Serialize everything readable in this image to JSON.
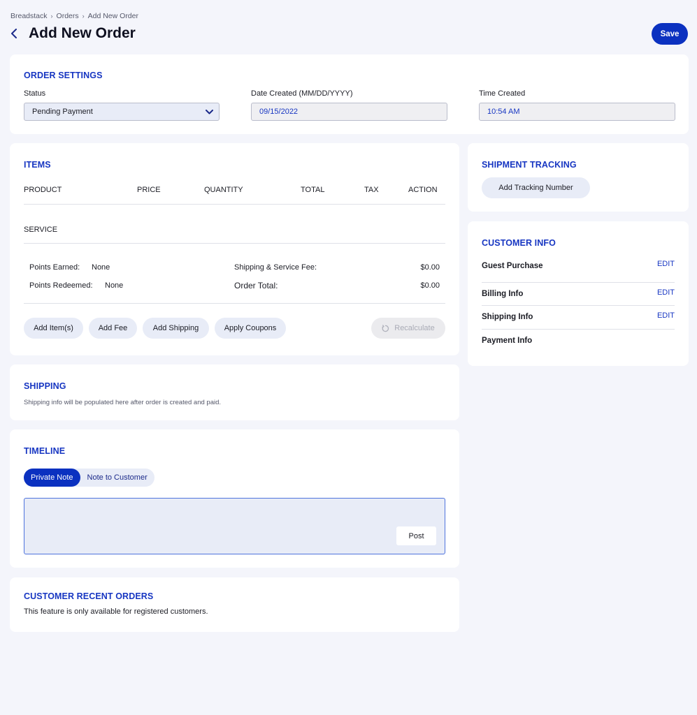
{
  "breadcrumb": [
    "Breadstack",
    "Orders",
    "Add New Order"
  ],
  "page_title": "Add New Order",
  "save_label": "Save",
  "order_settings": {
    "title": "ORDER SETTINGS",
    "status_label": "Status",
    "status_value": "Pending Payment",
    "date_label": "Date Created (MM/DD/YYYY)",
    "date_value": "09/15/2022",
    "time_label": "Time Created",
    "time_value": "10:54 AM"
  },
  "items": {
    "title": "ITEMS",
    "columns": [
      "PRODUCT",
      "PRICE",
      "QUANTITY",
      "TOTAL",
      "TAX",
      "ACTION"
    ],
    "service_label": "SERVICE",
    "points_earned_label": "Points Earned:",
    "points_earned_value": "None",
    "points_redeemed_label": "Points Redeemed:",
    "points_redeemed_value": "None",
    "shipping_fee_label": "Shipping & Service Fee:",
    "shipping_fee_value": "$0.00",
    "order_total_label": "Order Total:",
    "order_total_value": "$0.00",
    "buttons": {
      "add_items": "Add Item(s)",
      "add_fee": "Add Fee",
      "add_shipping": "Add Shipping",
      "apply_coupons": "Apply Coupons",
      "recalculate": "Recalculate"
    }
  },
  "shipping": {
    "title": "SHIPPING",
    "note": "Shipping info will be populated here after order is created and paid."
  },
  "timeline": {
    "title": "TIMELINE",
    "tabs": [
      "Private Note",
      "Note to Customer"
    ],
    "active_tab": "Private Note",
    "note_value": "",
    "post_label": "Post"
  },
  "recent_orders": {
    "title": "CUSTOMER RECENT ORDERS",
    "note": "This feature is only available for registered customers."
  },
  "shipment_tracking": {
    "title": "SHIPMENT TRACKING",
    "button": "Add Tracking Number"
  },
  "customer_info": {
    "title": "CUSTOMER INFO",
    "guest_purchase": "Guest Purchase",
    "billing_info": "Billing Info",
    "shipping_info": "Shipping Info",
    "payment_info": "Payment Info",
    "edit_label": "EDIT"
  },
  "colors": {
    "accent": "#0b31c0",
    "section_title": "#1736c2",
    "background": "#f4f5fb",
    "pill": "#e8ecf7"
  },
  "icons": {
    "back": "chevron-left-icon",
    "breadcrumb_separator": "chevron-right-icon",
    "status_dropdown": "chevron-down-icon",
    "recalculate": "refresh-icon"
  }
}
